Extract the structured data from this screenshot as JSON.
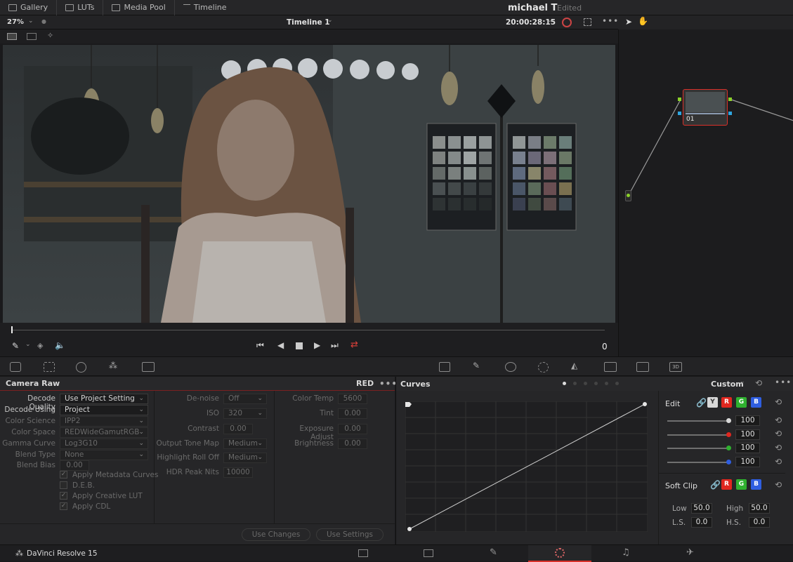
{
  "topbar": {
    "tabs": [
      {
        "label": "Gallery",
        "icon": "gallery-icon"
      },
      {
        "label": "LUTs",
        "icon": "luts-icon"
      },
      {
        "label": "Media Pool",
        "icon": "media-pool-icon"
      },
      {
        "label": "Timeline",
        "icon": "timeline-icon"
      }
    ],
    "project_name": "michael T",
    "project_status": "Edited"
  },
  "viewer_bar": {
    "zoom": "27%",
    "timeline_name": "Timeline 1",
    "timecode": "20:00:28:15",
    "frame_counter": "0"
  },
  "node": {
    "label": "01"
  },
  "camera_raw": {
    "title": "Camera Raw",
    "format": "RED",
    "col1": [
      {
        "label": "Decode Quality",
        "value": "Use Project Setting",
        "dim": false
      },
      {
        "label": "Decode Using",
        "value": "Project",
        "dim": false
      },
      {
        "label": "Color Science",
        "value": "IPP2",
        "dim": true
      },
      {
        "label": "Color Space",
        "value": "REDWideGamutRGB",
        "dim": true
      },
      {
        "label": "Gamma Curve",
        "value": "Log3G10",
        "dim": true
      },
      {
        "label": "Blend Type",
        "value": "None",
        "dim": true
      },
      {
        "label": "Blend Bias",
        "value": "0.00",
        "dim": true
      }
    ],
    "checkboxes": [
      {
        "label": "Apply Metadata Curves",
        "checked": true
      },
      {
        "label": "D.E.B.",
        "checked": false
      },
      {
        "label": "Apply Creative LUT",
        "checked": true
      },
      {
        "label": "Apply CDL",
        "checked": true
      }
    ],
    "col2": [
      {
        "label": "De-noise",
        "value": "Off"
      },
      {
        "label": "ISO",
        "value": "320"
      },
      {
        "label": "Contrast",
        "value": "0.00"
      },
      {
        "label": "Output Tone Map",
        "value": "Medium"
      },
      {
        "label": "Highlight Roll Off",
        "value": "Medium"
      },
      {
        "label": "HDR Peak Nits",
        "value": "10000"
      }
    ],
    "col3": [
      {
        "label": "Color Temp",
        "value": "5600"
      },
      {
        "label": "Tint",
        "value": "0.00"
      },
      {
        "label": "Exposure Adjust",
        "value": "0.00"
      },
      {
        "label": "Brightness",
        "value": "0.00"
      }
    ],
    "use_changes": "Use Changes",
    "use_settings": "Use Settings"
  },
  "curves": {
    "title": "Curves",
    "mode": "Custom",
    "edit_label": "Edit",
    "channels": [
      "Y",
      "R",
      "G",
      "B"
    ],
    "channel_values": [
      "100",
      "100",
      "100",
      "100"
    ],
    "channel_levels": [
      1.0,
      1.0,
      1.0,
      1.0
    ],
    "soft_clip_label": "Soft Clip",
    "soft_channels": [
      "R",
      "G",
      "B"
    ],
    "low_label": "Low",
    "low_value": "50.0",
    "high_label": "High",
    "high_value": "50.0",
    "ls_label": "L.S.",
    "ls_value": "0.0",
    "hs_label": "H.S.",
    "hs_value": "0.0"
  },
  "status": {
    "app": "DaVinci Resolve 15"
  },
  "colors": {
    "accent": "#d9302a",
    "red": "#e0271f",
    "green": "#2fb12f",
    "blue": "#2f5ee0"
  }
}
